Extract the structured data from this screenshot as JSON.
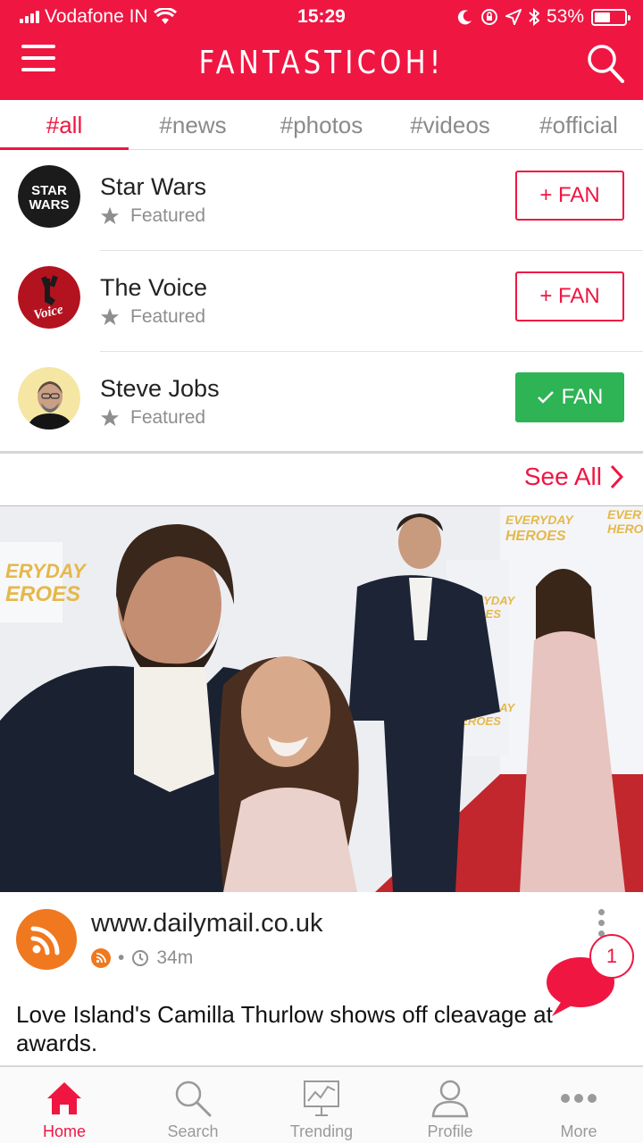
{
  "status_bar": {
    "carrier": "Vodafone IN",
    "time": "15:29",
    "battery_percent": "53%",
    "battery_level": 0.53
  },
  "header": {
    "logo": "FANTASTICOH!",
    "menu_icon": "hamburger-icon",
    "search_icon": "search-icon"
  },
  "tabs": [
    {
      "label": "#all",
      "active": true
    },
    {
      "label": "#news"
    },
    {
      "label": "#photos"
    },
    {
      "label": "#videos"
    },
    {
      "label": "#official"
    }
  ],
  "featured": [
    {
      "name": "Star Wars",
      "tag": "Featured",
      "button": "+ FAN",
      "fanned": false,
      "avatar_text": "STAR WARS"
    },
    {
      "name": "The Voice",
      "tag": "Featured",
      "button": "+ FAN",
      "fanned": false,
      "avatar_text": "Voice"
    },
    {
      "name": "Steve Jobs",
      "tag": "Featured",
      "button": "FAN",
      "fanned": true
    }
  ],
  "see_all": "See All",
  "article": {
    "source": "www.dailymail.co.uk",
    "time": "34m",
    "headline": "Love Island's Camilla Thurlow shows off cleavage at awards.",
    "image_banner": "EVERYDAY HEROES"
  },
  "notification_count": "1",
  "bottom_nav": [
    {
      "label": "Home",
      "icon": "home-icon",
      "active": true
    },
    {
      "label": "Search",
      "icon": "search-icon"
    },
    {
      "label": "Trending",
      "icon": "trending-icon"
    },
    {
      "label": "Profile",
      "icon": "profile-icon"
    },
    {
      "label": "More",
      "icon": "more-icon"
    }
  ],
  "colors": {
    "brand": "#ef1642",
    "fan_active": "#2eb355",
    "rss": "#f0781f"
  }
}
